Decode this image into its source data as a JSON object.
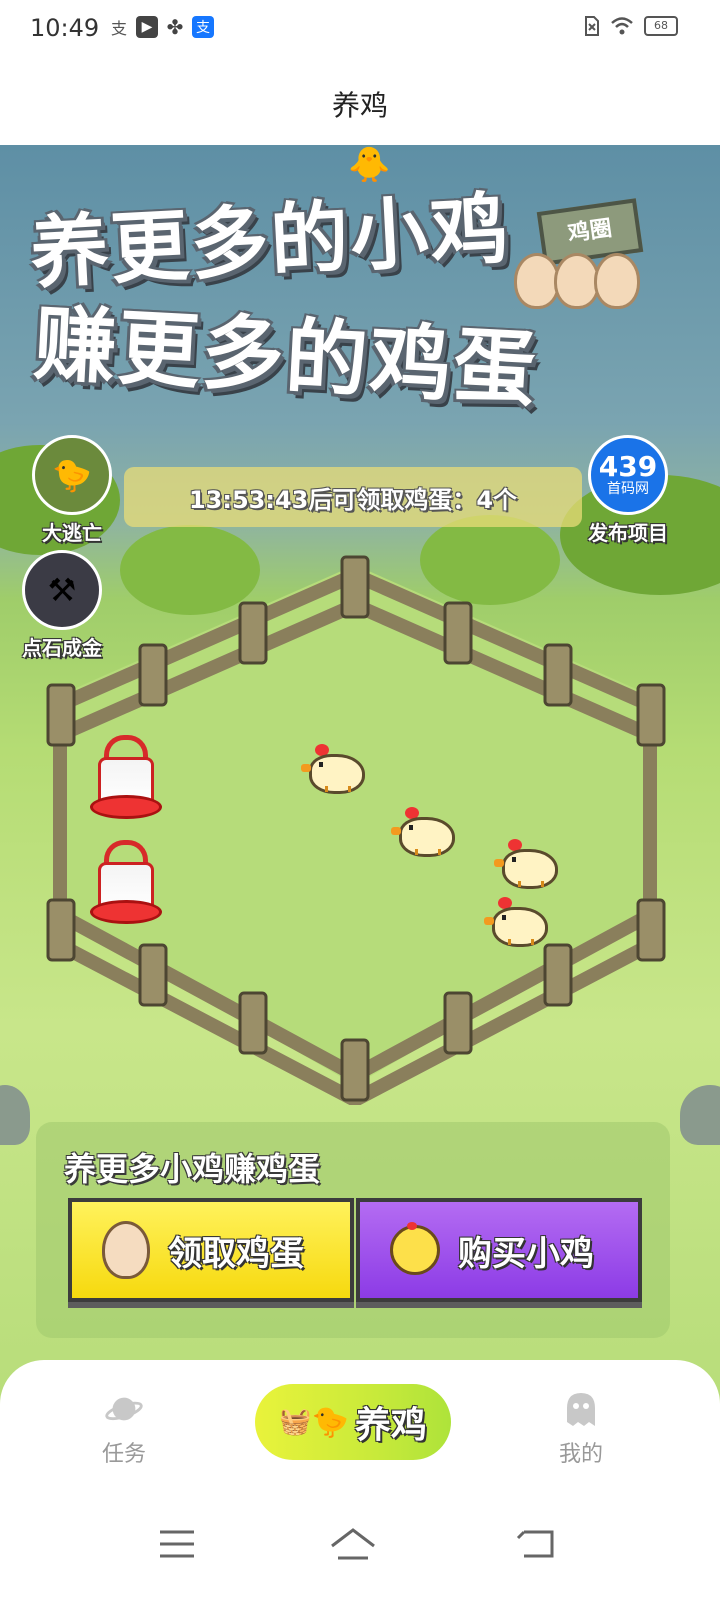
{
  "status_bar": {
    "time": "10:49",
    "battery": "68",
    "left_icons": [
      "alipay-icon",
      "play-icon",
      "fan-icon",
      "alipay-badge-icon"
    ],
    "right_icons": [
      "sim-icon",
      "wifi-icon",
      "battery-icon"
    ]
  },
  "header": {
    "title": "养鸡"
  },
  "game": {
    "headline_line1": "养更多的小鸡",
    "headline_line2": "赚更多的鸡蛋",
    "sign_label": "鸡圈",
    "timer_text": "13:53:43后可领取鸡蛋：4个",
    "side_buttons": [
      {
        "label": "大逃亡",
        "icon": "game-avatar-icon"
      },
      {
        "label": "点石成金",
        "icon": "game-avatar-icon"
      },
      {
        "label": "发布项目",
        "icon": "439-logo"
      }
    ],
    "ad_logo": {
      "number": "439",
      "subtitle": "首码网"
    },
    "chickens": 4,
    "feeders": 2
  },
  "actions": {
    "title": "养更多小鸡赚鸡蛋",
    "collect_label": "领取鸡蛋",
    "buy_label": "购买小鸡"
  },
  "bottom_nav": {
    "items": [
      {
        "label": "任务",
        "icon": "planet-icon"
      },
      {
        "label": "养鸡",
        "icon": "chicken-icon"
      },
      {
        "label": "我的",
        "icon": "ghost-icon"
      }
    ]
  },
  "colors": {
    "collect_button": "#f6d90e",
    "buy_button": "#8c3be6",
    "nav_center": "#c9ea3a",
    "ad_blue": "#1a73e8"
  }
}
